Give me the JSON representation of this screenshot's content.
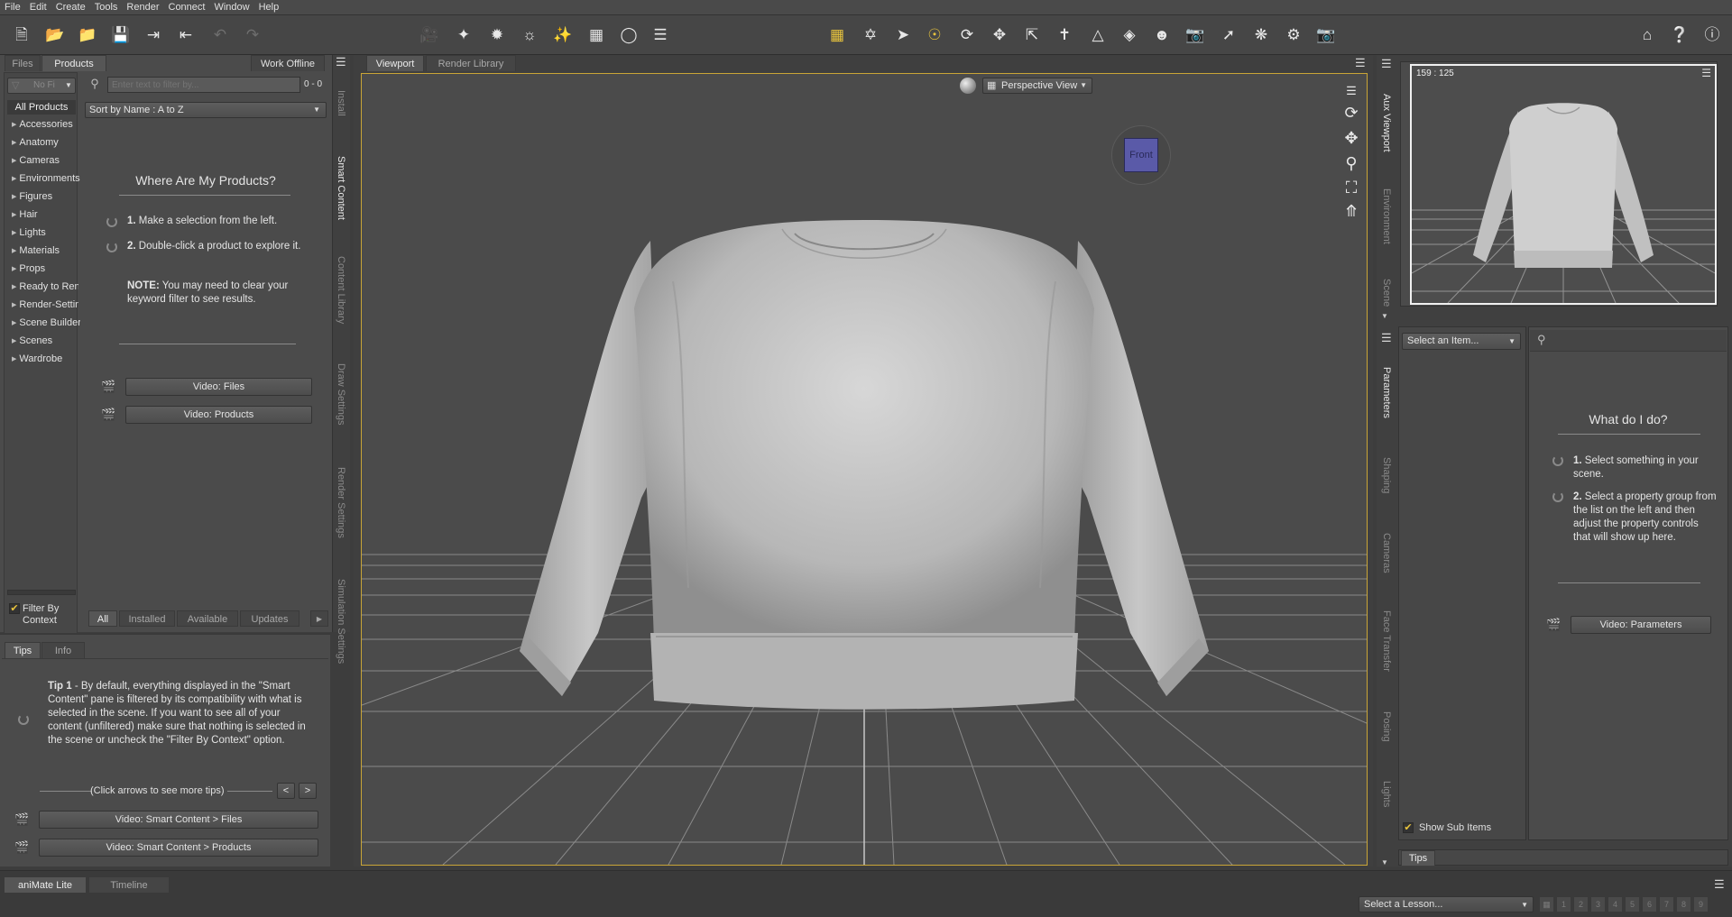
{
  "menu": [
    "File",
    "Edit",
    "Create",
    "Tools",
    "Render",
    "Connect",
    "Window",
    "Help"
  ],
  "left_panel": {
    "tabs": {
      "files": "Files",
      "products": "Products"
    },
    "work_offline": "Work Offline",
    "no_filter": "No Fi",
    "search_placeholder": "Enter text to filter by...",
    "count": "0 - 0",
    "sort": "Sort by Name : A to Z",
    "all_products": "All Products",
    "categories": [
      "Accessories",
      "Anatomy",
      "Cameras",
      "Environments",
      "Figures",
      "Hair",
      "Lights",
      "Materials",
      "Props",
      "Ready to Rend",
      "Render-Settin",
      "Scene Builder",
      "Scenes",
      "Wardrobe"
    ],
    "filter_by_context": "Filter By Context",
    "help_title": "Where Are My Products?",
    "step1_num": "1.",
    "step1": "Make a selection from the left.",
    "step2_num": "2.",
    "step2": "Double-click a product to explore it.",
    "note_label": "NOTE:",
    "note": "You may need to clear your keyword filter to see results.",
    "video_files": "Video: Files",
    "video_products": "Video: Products",
    "status_tabs": [
      "All",
      "Installed",
      "Available",
      "Updates"
    ],
    "vtabs": [
      "Install",
      "Smart Content",
      "Content Library",
      "Draw Settings",
      "Render Settings",
      "Simulation Settings"
    ]
  },
  "tips_panel": {
    "tabs": [
      "Tips",
      "Info"
    ],
    "tip_label": "Tip 1",
    "tip_text": " - By default, everything displayed in the \"Smart Content\" pane is filtered by its compatibility with what is selected in the scene. If you want to see all of your content (unfiltered) make sure that nothing is selected in the scene or uncheck the \"Filter By Context\" option.",
    "nav_hint": "(Click arrows to see more tips)",
    "prev": "<",
    "next": ">",
    "video1": "Video: Smart Content > Files",
    "video2": "Video: Smart Content > Products"
  },
  "viewport": {
    "tabs": [
      "Viewport",
      "Render Library"
    ],
    "view": "Perspective View",
    "cube_face": "Front"
  },
  "right_panel": {
    "aux_label": "159 : 125",
    "vtabs_top": [
      "Aux Viewport",
      "Environment",
      "Scene"
    ],
    "vtabs": [
      "Parameters",
      "Shaping",
      "Cameras",
      "Face Transfer",
      "Posing",
      "Lights"
    ],
    "select_item": "Select an Item...",
    "help_title": "What do I do?",
    "step1_num": "1.",
    "step1": "Select something in your scene.",
    "step2_num": "2.",
    "step2": "Select a property group from the list on the left and then adjust the property controls that will show up here.",
    "video": "Video: Parameters",
    "show_sub_items": "Show Sub Items",
    "tips_tab": "Tips"
  },
  "bottom": {
    "tabs": [
      "aniMate Lite",
      "Timeline"
    ],
    "lesson": "Select a Lesson...",
    "lesson_steps": [
      "1",
      "2",
      "3",
      "4",
      "5",
      "6",
      "7",
      "8",
      "9"
    ]
  },
  "colors": {
    "accent": "#e7c33d",
    "viewport_bg": "#4b4b4b",
    "panel": "#4b4b4b",
    "cube": "#5a5aa8"
  }
}
